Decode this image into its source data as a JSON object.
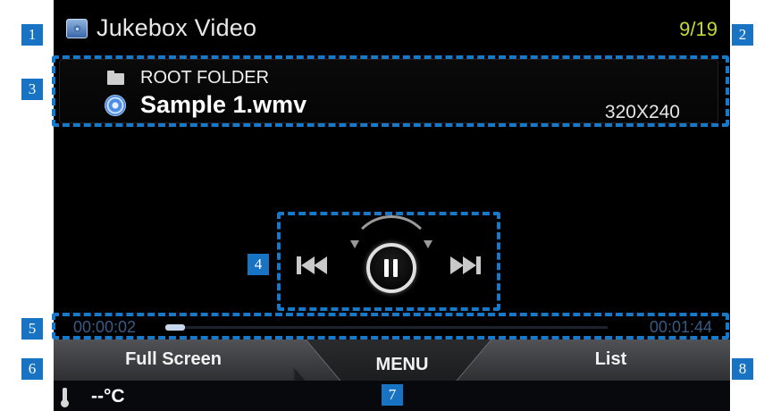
{
  "header": {
    "title": "Jukebox Video",
    "track_position": "9/19",
    "icon": "jukebox-app-icon"
  },
  "file_info": {
    "folder_name": "ROOT FOLDER",
    "file_name": "Sample 1.wmv",
    "resolution": "320X240",
    "folder_icon": "folder-icon",
    "file_icon": "video-file-icon"
  },
  "playback": {
    "state": "playing",
    "controls": [
      "previous-track",
      "pause",
      "next-track"
    ]
  },
  "progress": {
    "elapsed": "00:00:02",
    "total": "00:01:44",
    "fraction": 0.02
  },
  "menu": {
    "full_screen": "Full Screen",
    "menu": "MENU",
    "list": "List"
  },
  "status": {
    "temperature": "--°C",
    "icon": "thermometer-icon"
  },
  "callouts": [
    "1",
    "2",
    "3",
    "4",
    "5",
    "6",
    "7",
    "8"
  ],
  "colors": {
    "callout": "#1874c3",
    "track_count": "#c5da37",
    "time_text": "#3a5a86",
    "background": "#000000"
  }
}
